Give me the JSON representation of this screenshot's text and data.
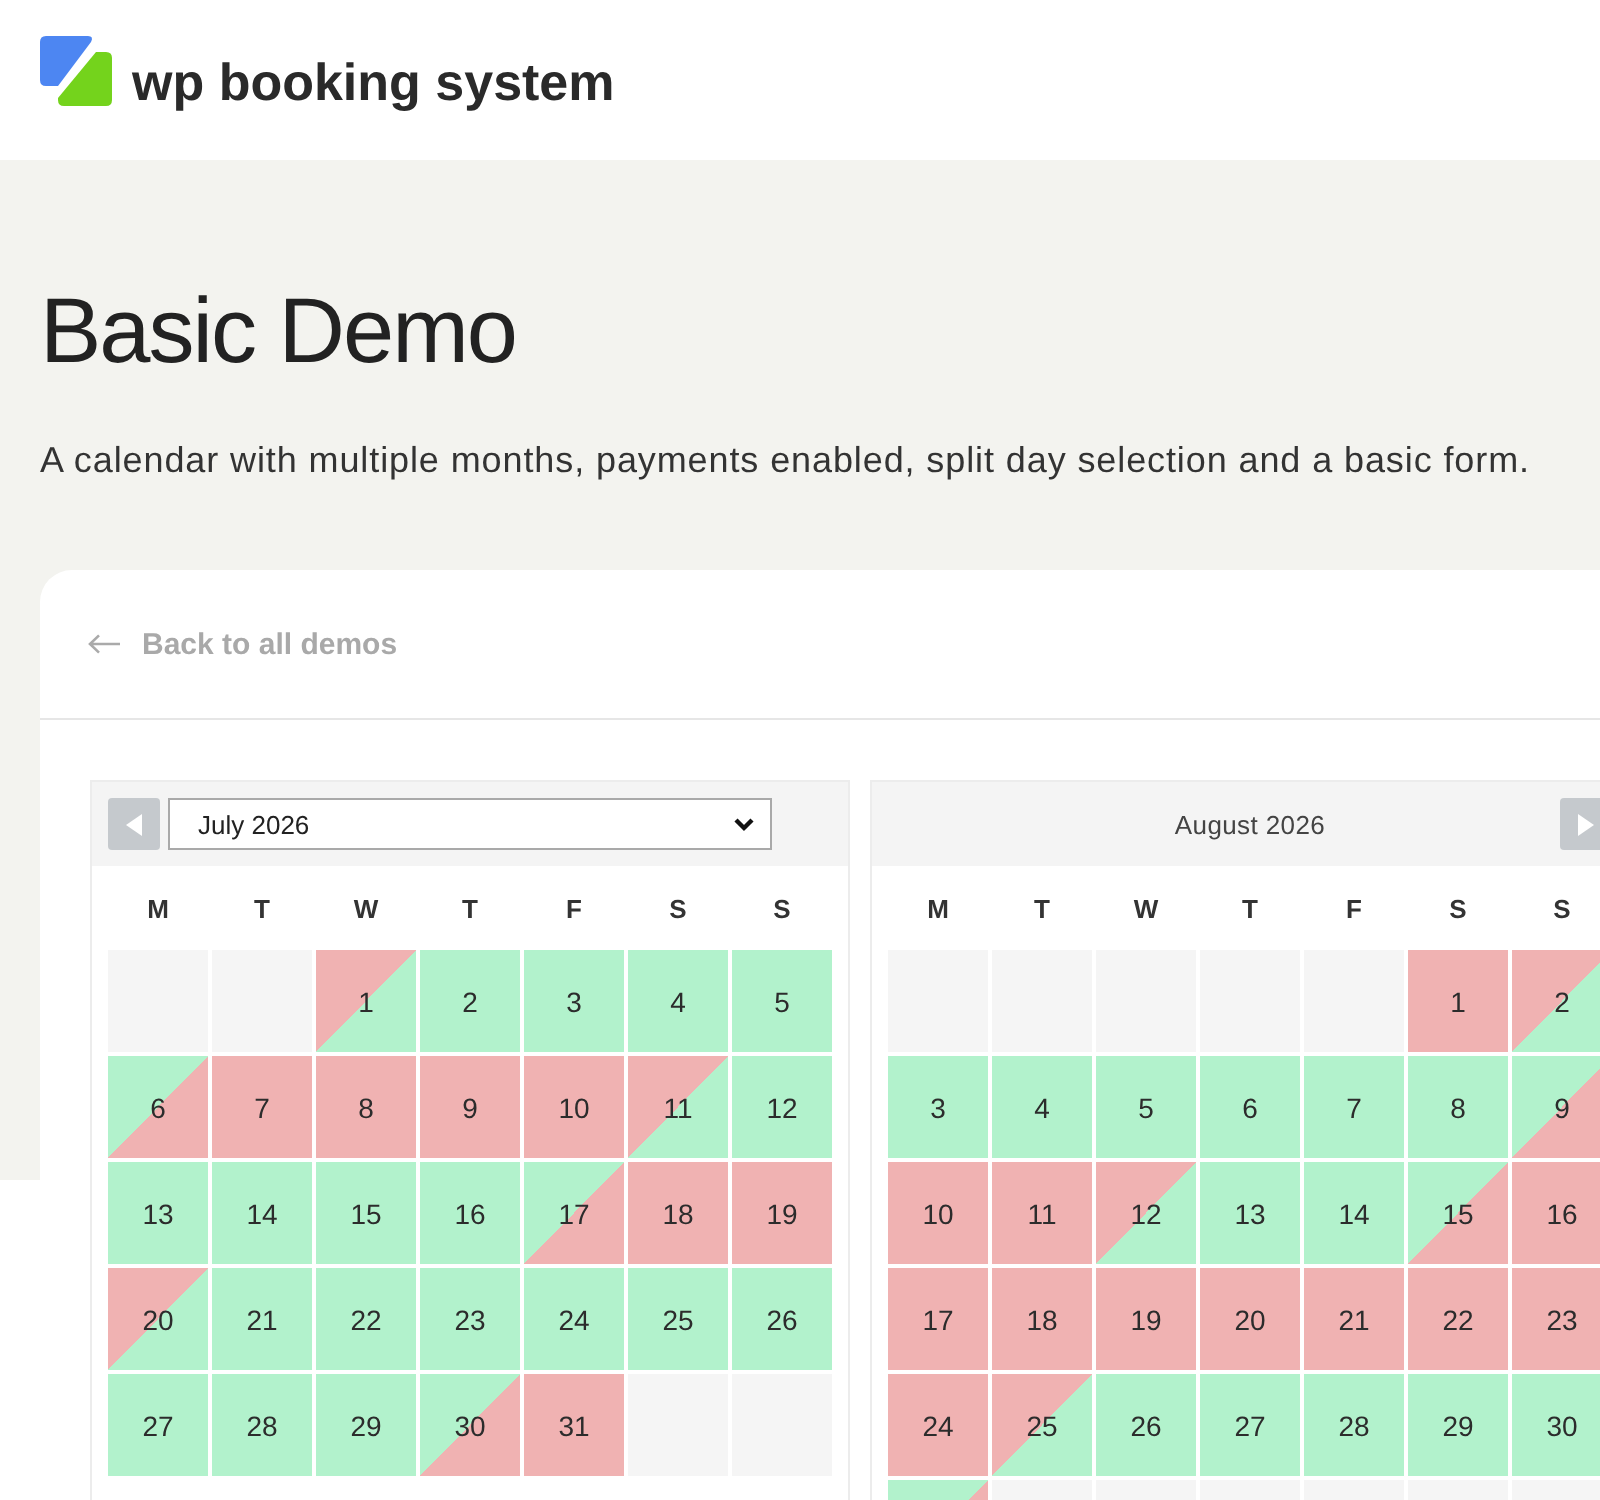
{
  "header": {
    "brand": "wp booking system"
  },
  "hero": {
    "title": "Basic Demo",
    "description": "A calendar with multiple months, payments enabled, split day selection and a basic form."
  },
  "card": {
    "back_link": "Back to all demos",
    "calendars": [
      {
        "header": {
          "kind": "select",
          "label": "July 2026"
        },
        "prev_button": true,
        "next_button": false,
        "weekdays": [
          "M",
          "T",
          "W",
          "T",
          "F",
          "S",
          "S"
        ],
        "weeks": [
          [
            {
              "kind": "empty"
            },
            {
              "kind": "empty"
            },
            {
              "kind": "day",
              "day": "1",
              "booked_first_half": true,
              "booked_second_half": false
            },
            {
              "kind": "day",
              "day": "2",
              "booked_first_half": false,
              "booked_second_half": false
            },
            {
              "kind": "day",
              "day": "3",
              "booked_first_half": false,
              "booked_second_half": false
            },
            {
              "kind": "day",
              "day": "4",
              "booked_first_half": false,
              "booked_second_half": false
            },
            {
              "kind": "day",
              "day": "5",
              "booked_first_half": false,
              "booked_second_half": false
            }
          ],
          [
            {
              "kind": "day",
              "day": "6",
              "booked_first_half": false,
              "booked_second_half": true
            },
            {
              "kind": "day",
              "day": "7",
              "booked_first_half": true,
              "booked_second_half": true
            },
            {
              "kind": "day",
              "day": "8",
              "booked_first_half": true,
              "booked_second_half": true
            },
            {
              "kind": "day",
              "day": "9",
              "booked_first_half": true,
              "booked_second_half": true
            },
            {
              "kind": "day",
              "day": "10",
              "booked_first_half": true,
              "booked_second_half": true
            },
            {
              "kind": "day",
              "day": "11",
              "booked_first_half": true,
              "booked_second_half": false
            },
            {
              "kind": "day",
              "day": "12",
              "booked_first_half": false,
              "booked_second_half": false
            }
          ],
          [
            {
              "kind": "day",
              "day": "13",
              "booked_first_half": false,
              "booked_second_half": false
            },
            {
              "kind": "day",
              "day": "14",
              "booked_first_half": false,
              "booked_second_half": false
            },
            {
              "kind": "day",
              "day": "15",
              "booked_first_half": false,
              "booked_second_half": false
            },
            {
              "kind": "day",
              "day": "16",
              "booked_first_half": false,
              "booked_second_half": false
            },
            {
              "kind": "day",
              "day": "17",
              "booked_first_half": false,
              "booked_second_half": true
            },
            {
              "kind": "day",
              "day": "18",
              "booked_first_half": true,
              "booked_second_half": true
            },
            {
              "kind": "day",
              "day": "19",
              "booked_first_half": true,
              "booked_second_half": true
            }
          ],
          [
            {
              "kind": "day",
              "day": "20",
              "booked_first_half": true,
              "booked_second_half": false
            },
            {
              "kind": "day",
              "day": "21",
              "booked_first_half": false,
              "booked_second_half": false
            },
            {
              "kind": "day",
              "day": "22",
              "booked_first_half": false,
              "booked_second_half": false
            },
            {
              "kind": "day",
              "day": "23",
              "booked_first_half": false,
              "booked_second_half": false
            },
            {
              "kind": "day",
              "day": "24",
              "booked_first_half": false,
              "booked_second_half": false
            },
            {
              "kind": "day",
              "day": "25",
              "booked_first_half": false,
              "booked_second_half": false
            },
            {
              "kind": "day",
              "day": "26",
              "booked_first_half": false,
              "booked_second_half": false
            }
          ],
          [
            {
              "kind": "day",
              "day": "27",
              "booked_first_half": false,
              "booked_second_half": false
            },
            {
              "kind": "day",
              "day": "28",
              "booked_first_half": false,
              "booked_second_half": false
            },
            {
              "kind": "day",
              "day": "29",
              "booked_first_half": false,
              "booked_second_half": false
            },
            {
              "kind": "day",
              "day": "30",
              "booked_first_half": false,
              "booked_second_half": true
            },
            {
              "kind": "day",
              "day": "31",
              "booked_first_half": true,
              "booked_second_half": true
            },
            {
              "kind": "empty"
            },
            {
              "kind": "empty"
            }
          ]
        ]
      },
      {
        "header": {
          "kind": "title",
          "label": "August 2026"
        },
        "prev_button": false,
        "next_button": true,
        "weekdays": [
          "M",
          "T",
          "W",
          "T",
          "F",
          "S",
          "S"
        ],
        "weeks": [
          [
            {
              "kind": "empty"
            },
            {
              "kind": "empty"
            },
            {
              "kind": "empty"
            },
            {
              "kind": "empty"
            },
            {
              "kind": "empty"
            },
            {
              "kind": "day",
              "day": "1",
              "booked_first_half": true,
              "booked_second_half": true
            },
            {
              "kind": "day",
              "day": "2",
              "booked_first_half": true,
              "booked_second_half": false
            }
          ],
          [
            {
              "kind": "day",
              "day": "3",
              "booked_first_half": false,
              "booked_second_half": false
            },
            {
              "kind": "day",
              "day": "4",
              "booked_first_half": false,
              "booked_second_half": false
            },
            {
              "kind": "day",
              "day": "5",
              "booked_first_half": false,
              "booked_second_half": false
            },
            {
              "kind": "day",
              "day": "6",
              "booked_first_half": false,
              "booked_second_half": false
            },
            {
              "kind": "day",
              "day": "7",
              "booked_first_half": false,
              "booked_second_half": false
            },
            {
              "kind": "day",
              "day": "8",
              "booked_first_half": false,
              "booked_second_half": false
            },
            {
              "kind": "day",
              "day": "9",
              "booked_first_half": false,
              "booked_second_half": true
            }
          ],
          [
            {
              "kind": "day",
              "day": "10",
              "booked_first_half": true,
              "booked_second_half": true
            },
            {
              "kind": "day",
              "day": "11",
              "booked_first_half": true,
              "booked_second_half": true
            },
            {
              "kind": "day",
              "day": "12",
              "booked_first_half": true,
              "booked_second_half": false
            },
            {
              "kind": "day",
              "day": "13",
              "booked_first_half": false,
              "booked_second_half": false
            },
            {
              "kind": "day",
              "day": "14",
              "booked_first_half": false,
              "booked_second_half": false
            },
            {
              "kind": "day",
              "day": "15",
              "booked_first_half": false,
              "booked_second_half": true
            },
            {
              "kind": "day",
              "day": "16",
              "booked_first_half": true,
              "booked_second_half": true
            }
          ],
          [
            {
              "kind": "day",
              "day": "17",
              "booked_first_half": true,
              "booked_second_half": true
            },
            {
              "kind": "day",
              "day": "18",
              "booked_first_half": true,
              "booked_second_half": true
            },
            {
              "kind": "day",
              "day": "19",
              "booked_first_half": true,
              "booked_second_half": true
            },
            {
              "kind": "day",
              "day": "20",
              "booked_first_half": true,
              "booked_second_half": true
            },
            {
              "kind": "day",
              "day": "21",
              "booked_first_half": true,
              "booked_second_half": true
            },
            {
              "kind": "day",
              "day": "22",
              "booked_first_half": true,
              "booked_second_half": true
            },
            {
              "kind": "day",
              "day": "23",
              "booked_first_half": true,
              "booked_second_half": true
            }
          ],
          [
            {
              "kind": "day",
              "day": "24",
              "booked_first_half": true,
              "booked_second_half": true
            },
            {
              "kind": "day",
              "day": "25",
              "booked_first_half": true,
              "booked_second_half": false
            },
            {
              "kind": "day",
              "day": "26",
              "booked_first_half": false,
              "booked_second_half": false
            },
            {
              "kind": "day",
              "day": "27",
              "booked_first_half": false,
              "booked_second_half": false
            },
            {
              "kind": "day",
              "day": "28",
              "booked_first_half": false,
              "booked_second_half": false
            },
            {
              "kind": "day",
              "day": "29",
              "booked_first_half": false,
              "booked_second_half": false
            },
            {
              "kind": "day",
              "day": "30",
              "booked_first_half": false,
              "booked_second_half": false
            }
          ],
          [
            {
              "kind": "day",
              "booked_first_half": false,
              "booked_second_half": true
            },
            {
              "kind": "empty"
            },
            {
              "kind": "empty"
            },
            {
              "kind": "empty"
            },
            {
              "kind": "empty"
            },
            {
              "kind": "empty"
            },
            {
              "kind": "empty"
            }
          ]
        ]
      }
    ]
  }
}
